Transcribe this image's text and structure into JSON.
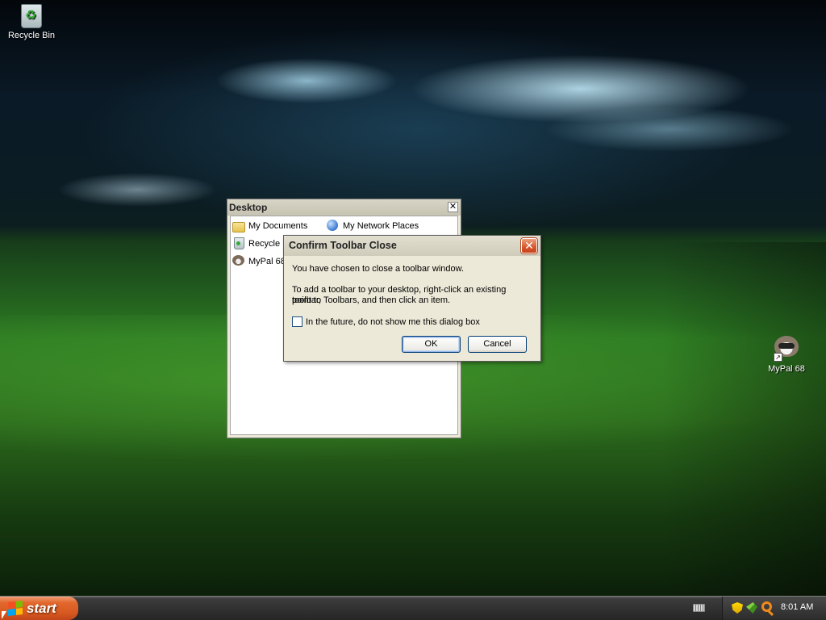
{
  "desktop": {
    "icons": [
      {
        "label": "Recycle Bin",
        "icon": "recycle-bin-icon"
      },
      {
        "label": "MyPal 68",
        "icon": "mypal-raccoon-icon"
      }
    ]
  },
  "toolbar_window": {
    "title": "Desktop",
    "close_glyph": "✕",
    "items": [
      {
        "label": "My Documents",
        "icon": "folder-icon"
      },
      {
        "label": "My Network Places",
        "icon": "network-places-icon"
      },
      {
        "label": "Recycle Bin",
        "icon": "recycle-bin-icon"
      },
      {
        "label": "MyPal 68",
        "icon": "mypal-raccoon-icon"
      }
    ]
  },
  "dialog": {
    "title": "Confirm Toolbar Close",
    "close_glyph": "✕",
    "message1": "You have chosen to close a toolbar window.",
    "message2_line1": "To add a toolbar to your desktop, right-click an existing toolbar,",
    "message2_line2": "point to Toolbars, and then click an item.",
    "checkbox_label": "In the future, do not show me this dialog box",
    "checkbox_checked": false,
    "ok_label": "OK",
    "cancel_label": "Cancel"
  },
  "taskbar": {
    "start_label": "start",
    "clock": "8:01 AM",
    "tray_icons": [
      "security-shield-icon",
      "network-icon",
      "search-icon"
    ],
    "colors": {
      "start": "#d75820",
      "taskbar": "#2f2f2f"
    }
  }
}
